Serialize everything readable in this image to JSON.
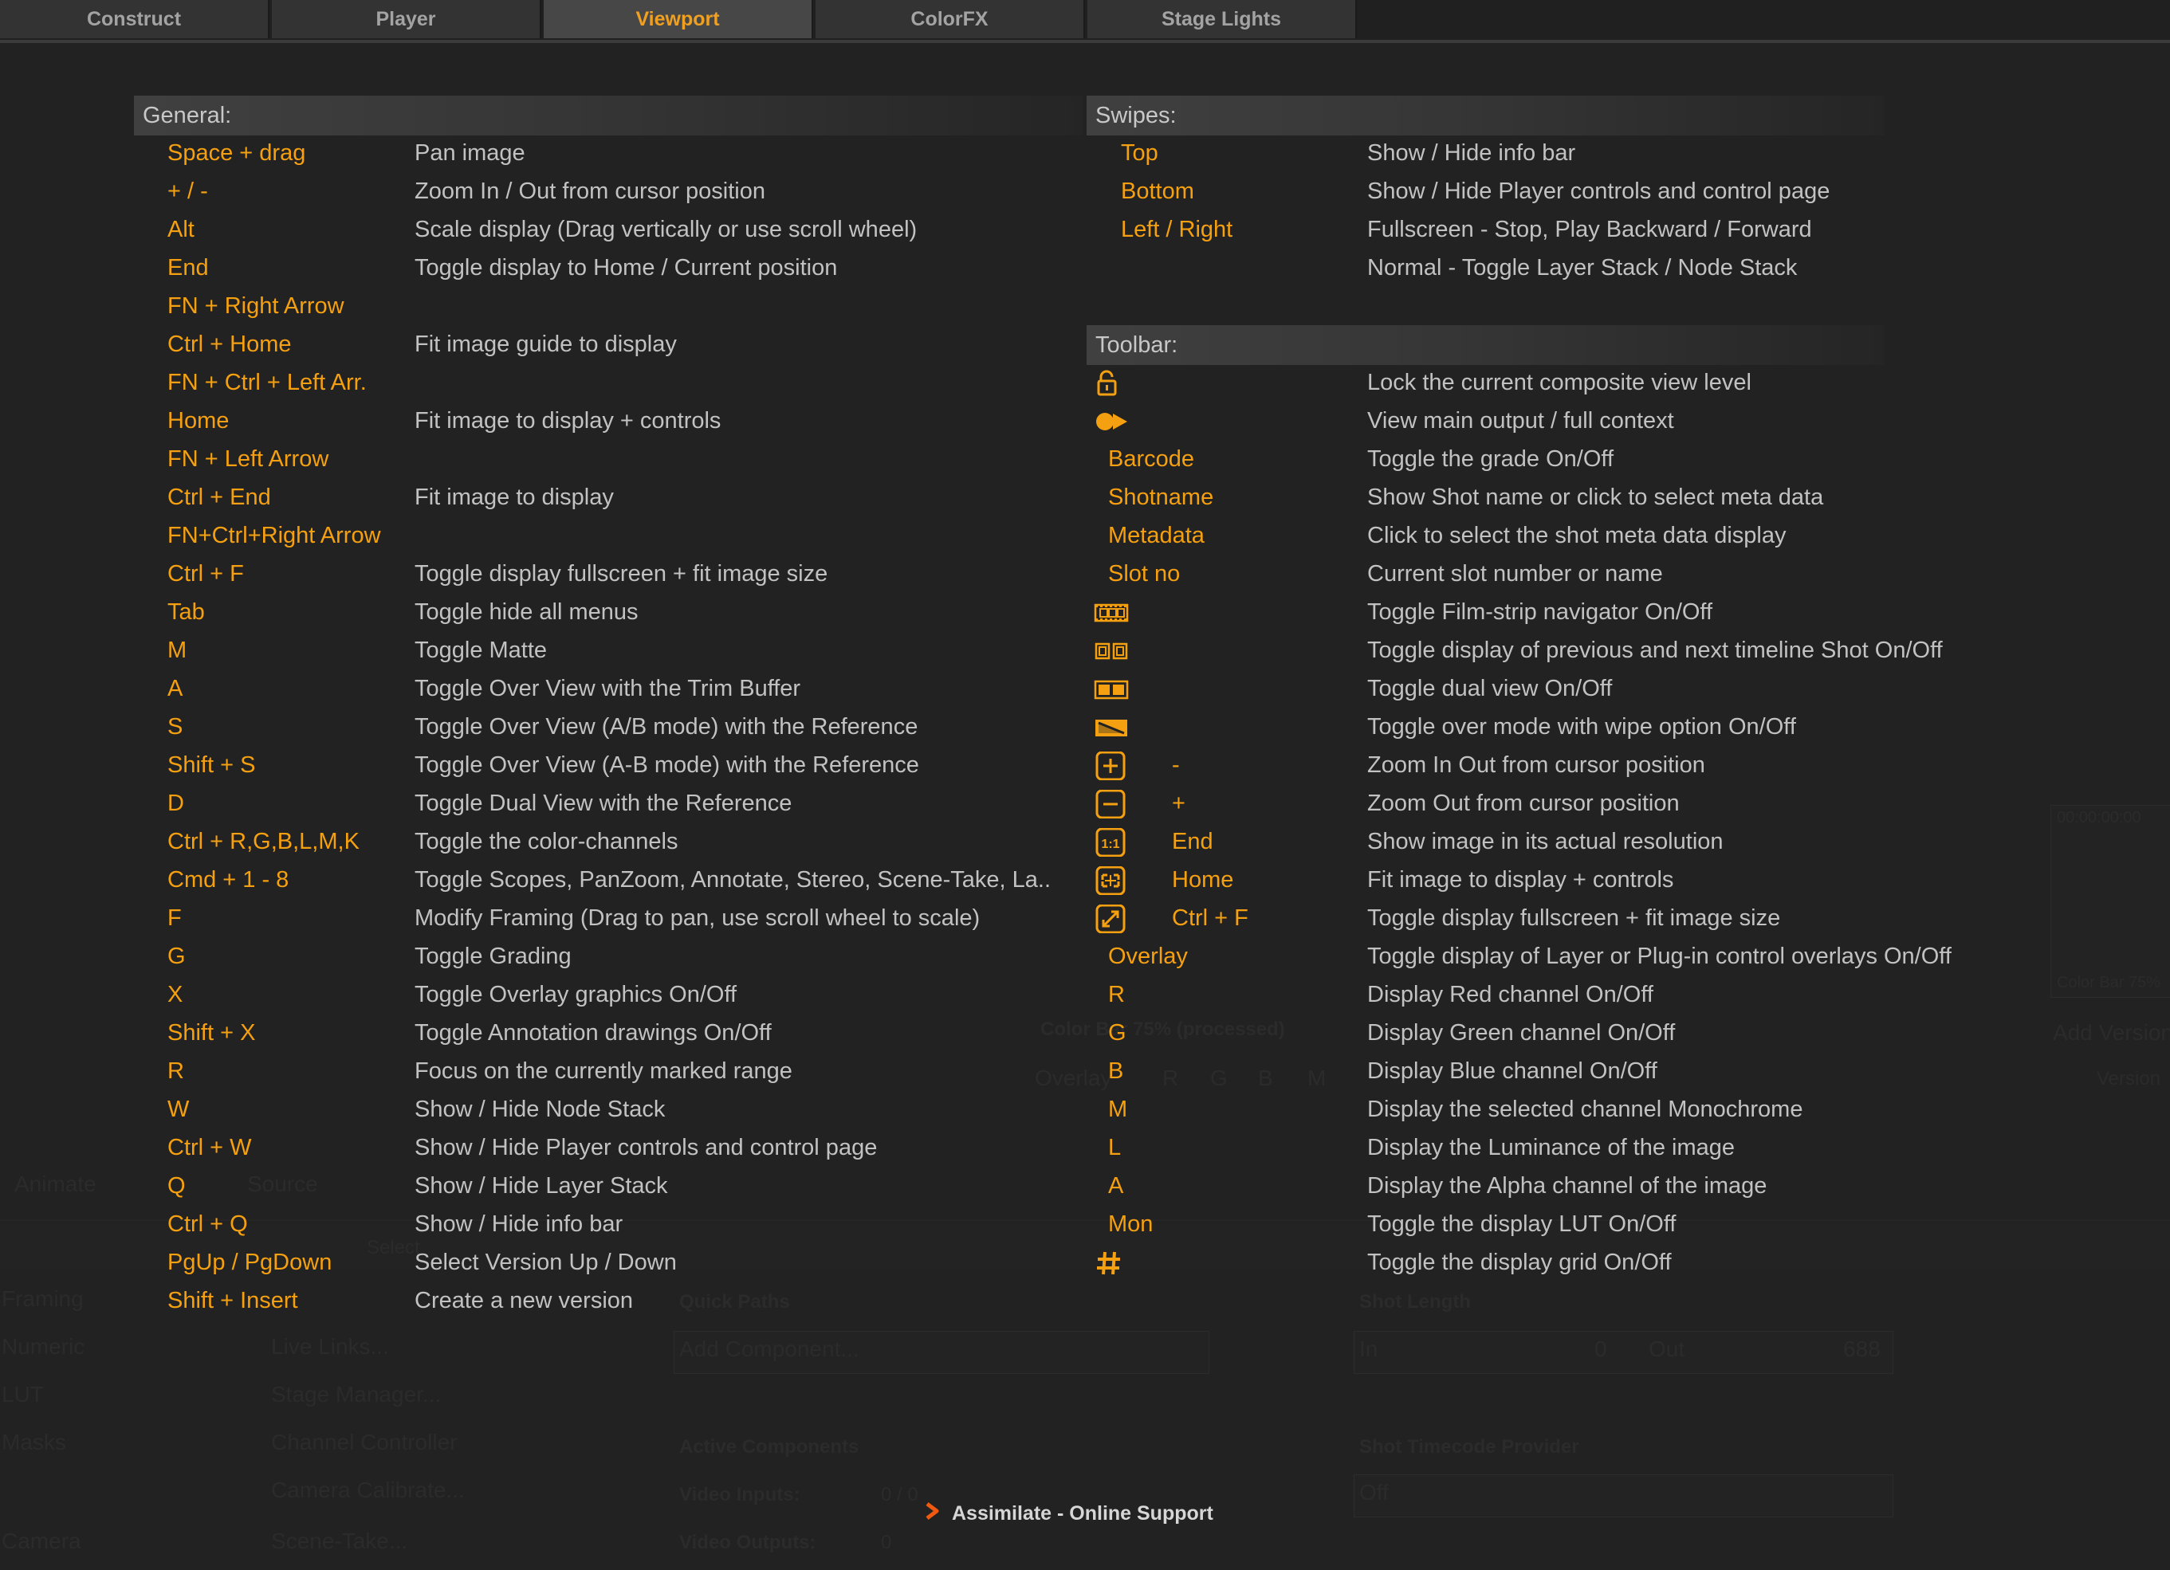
{
  "tabs": [
    {
      "label": "Construct",
      "active": false
    },
    {
      "label": "Player",
      "active": false
    },
    {
      "label": "Viewport",
      "active": true
    },
    {
      "label": "ColorFX",
      "active": false
    },
    {
      "label": "Stage Lights",
      "active": false
    }
  ],
  "colors": {
    "accent": "#f5a010",
    "text": "#c2c2c2",
    "background": "#222222"
  },
  "general": {
    "title": "General:",
    "rows": [
      {
        "key": "Space + drag",
        "desc": "Pan image"
      },
      {
        "key": "+ / -",
        "desc": "Zoom In / Out from cursor position"
      },
      {
        "key": "Alt",
        "desc": "Scale display (Drag vertically or use scroll wheel)"
      },
      {
        "key": "End",
        "desc": "Toggle display to Home / Current position"
      },
      {
        "key": "FN + Right Arrow",
        "desc": ""
      },
      {
        "key": "Ctrl + Home",
        "desc": "Fit image guide to display"
      },
      {
        "key": "FN + Ctrl + Left Arr.",
        "desc": ""
      },
      {
        "key": "Home",
        "desc": "Fit image to display + controls"
      },
      {
        "key": "FN + Left Arrow",
        "desc": ""
      },
      {
        "key": "Ctrl + End",
        "desc": "Fit image to display"
      },
      {
        "key": "FN+Ctrl+Right Arrow",
        "desc": ""
      },
      {
        "key": "Ctrl + F",
        "desc": "Toggle display fullscreen + fit image size"
      },
      {
        "key": "Tab",
        "desc": "Toggle hide all menus"
      },
      {
        "key": "M",
        "desc": "Toggle Matte"
      },
      {
        "key": "A",
        "desc": "Toggle Over View with the Trim Buffer"
      },
      {
        "key": "S",
        "desc": "Toggle Over View (A/B mode) with the Reference"
      },
      {
        "key": "Shift + S",
        "desc": "Toggle Over View (A-B mode) with the Reference"
      },
      {
        "key": "D",
        "desc": "Toggle Dual View with the Reference"
      },
      {
        "key": "Ctrl + R,G,B,L,M,K",
        "desc": "Toggle the color-channels"
      },
      {
        "key": "Cmd + 1 - 8",
        "desc": "Toggle Scopes, PanZoom, Annotate, Stereo, Scene-Take, La.."
      },
      {
        "key": "F",
        "desc": "Modify Framing (Drag to pan, use scroll wheel to scale)"
      },
      {
        "key": "G",
        "desc": "Toggle Grading"
      },
      {
        "key": "X",
        "desc": "Toggle Overlay graphics On/Off"
      },
      {
        "key": "Shift + X",
        "desc": "Toggle Annotation drawings On/Off"
      },
      {
        "key": "R",
        "desc": "Focus on the currently marked range"
      },
      {
        "key": "W",
        "desc": "Show / Hide Node Stack"
      },
      {
        "key": "Ctrl + W",
        "desc": "Show / Hide Player controls and control page"
      },
      {
        "key": "Q",
        "desc": "Show / Hide Layer Stack"
      },
      {
        "key": "Ctrl + Q",
        "desc": "Show / Hide info bar"
      },
      {
        "key": "PgUp / PgDown",
        "desc": "Select Version Up / Down"
      },
      {
        "key": "Shift + Insert",
        "desc": "Create a new version"
      }
    ]
  },
  "swipes": {
    "title": "Swipes:",
    "rows": [
      {
        "key": "Top",
        "desc": "Show / Hide info bar"
      },
      {
        "key": "Bottom",
        "desc": "Show / Hide Player controls and control page"
      },
      {
        "key": "Left / Right",
        "desc": "Fullscreen - Stop, Play Backward / Forward"
      },
      {
        "key": "",
        "desc": "Normal - Toggle Layer Stack / Node Stack"
      }
    ]
  },
  "toolbar": {
    "title": "Toolbar:",
    "rows": [
      {
        "icon": "lock-icon",
        "key": "",
        "desc": "Lock the current composite view level"
      },
      {
        "icon": "main-output-icon",
        "key": "",
        "desc": "View main output / full context"
      },
      {
        "icon": "",
        "key": "Barcode",
        "desc": "Toggle the grade On/Off"
      },
      {
        "icon": "",
        "key": "Shotname",
        "desc": "Show Shot name or click to select meta data"
      },
      {
        "icon": "",
        "key": "Metadata",
        "desc": "Click to select the shot meta data display"
      },
      {
        "icon": "",
        "key": "Slot no",
        "desc": "Current slot number or name"
      },
      {
        "icon": "filmstrip-icon",
        "key": "",
        "desc": "Toggle Film-strip navigator On/Off"
      },
      {
        "icon": "prev-next-shot-icon",
        "key": "",
        "desc": "Toggle display of previous and next timeline Shot On/Off"
      },
      {
        "icon": "dual-view-icon",
        "key": "",
        "desc": "Toggle dual view On/Off"
      },
      {
        "icon": "wipe-icon",
        "key": "",
        "desc": "Toggle over mode with wipe option On/Off"
      },
      {
        "icon": "zoom-in-icon",
        "key": "-",
        "desc": "Zoom In Out from cursor position"
      },
      {
        "icon": "zoom-out-icon",
        "key": "+",
        "desc": "Zoom Out from cursor position"
      },
      {
        "icon": "actual-size-icon",
        "key": "End",
        "desc": "Show image in its actual resolution"
      },
      {
        "icon": "fit-icon",
        "key": "Home",
        "desc": "Fit image to display + controls"
      },
      {
        "icon": "fullscreen-icon",
        "key": "Ctrl + F",
        "desc": "Toggle display fullscreen + fit image size"
      },
      {
        "icon": "",
        "key": "Overlay",
        "desc": "Toggle display of Layer or Plug-in control overlays On/Off"
      },
      {
        "icon": "",
        "key": "R",
        "desc": "Display Red channel On/Off"
      },
      {
        "icon": "",
        "key": "G",
        "desc": "Display Green channel On/Off"
      },
      {
        "icon": "",
        "key": "B",
        "desc": "Display Blue channel On/Off"
      },
      {
        "icon": "",
        "key": "M",
        "desc": "Display the selected channel Monochrome"
      },
      {
        "icon": "",
        "key": "L",
        "desc": "Display the Luminance of the image"
      },
      {
        "icon": "",
        "key": "A",
        "desc": "Display the Alpha channel of the image"
      },
      {
        "icon": "",
        "key": "Mon",
        "desc": "Toggle the display LUT On/Off"
      },
      {
        "icon": "grid-icon",
        "key": "",
        "desc": "Toggle the display grid On/Off"
      }
    ]
  },
  "support": {
    "label": "Assimilate - Online Support"
  },
  "background": {
    "labels": [
      "00:00:00:00",
      "Color Bar 75%",
      "Add Version",
      "Version",
      "Color Bar 75% (processed)",
      "Overlay",
      "R",
      "G",
      "B",
      "M",
      "Animate",
      "Source",
      "Select",
      "Framing",
      "Numeric",
      "LUT",
      "Masks",
      "Camera",
      "Live Links...",
      "Stage Manager...",
      "Channel Controller",
      "Camera Calibrate...",
      "Scene-Take...",
      "Quick Paths",
      "Add Component...",
      "Active Components",
      "Video Inputs:",
      "0 / 0",
      "Video Outputs:",
      "0",
      "Shot Length",
      "In",
      "0",
      "Out",
      "688",
      "Shot Timecode Provider",
      "Off"
    ]
  }
}
